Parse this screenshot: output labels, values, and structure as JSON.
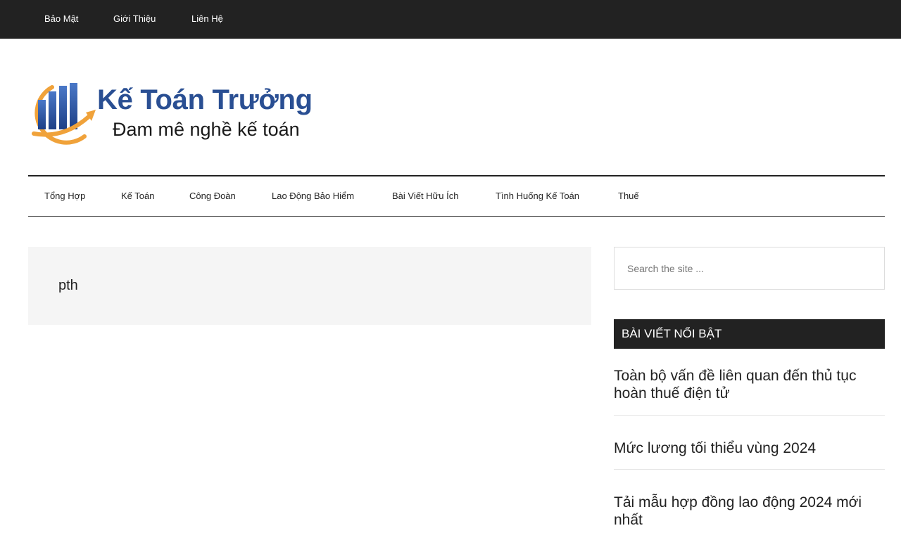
{
  "top_nav": {
    "items": [
      {
        "label": "Bảo Mật"
      },
      {
        "label": "Giới Thiệu"
      },
      {
        "label": "Liên Hệ"
      }
    ]
  },
  "site": {
    "title": "Kế Toán Trưởng",
    "tagline": "Đam mê nghề kế toán",
    "brand_color": "#2a4f93",
    "accent_color": "#f0a23a"
  },
  "main_nav": {
    "items": [
      {
        "label": "Tổng Hợp"
      },
      {
        "label": "Kế Toán"
      },
      {
        "label": "Công Đoàn"
      },
      {
        "label": "Lao Động Bảo Hiểm"
      },
      {
        "label": "Bài Viết Hữu Ích"
      },
      {
        "label": "Tình Huống Kế Toán"
      },
      {
        "label": "Thuế"
      }
    ]
  },
  "archive": {
    "title": "pth"
  },
  "sidebar": {
    "search_placeholder": "Search the site ...",
    "widget_title": "BÀI VIẾT NỔI BẬT",
    "posts": [
      {
        "title": "Toàn bộ vấn đề liên quan đến thủ tục hoàn thuế điện tử"
      },
      {
        "title": "Mức lương tối thiểu vùng 2024"
      },
      {
        "title": "Tải mẫu hợp đồng lao động 2024 mới nhất"
      }
    ]
  }
}
